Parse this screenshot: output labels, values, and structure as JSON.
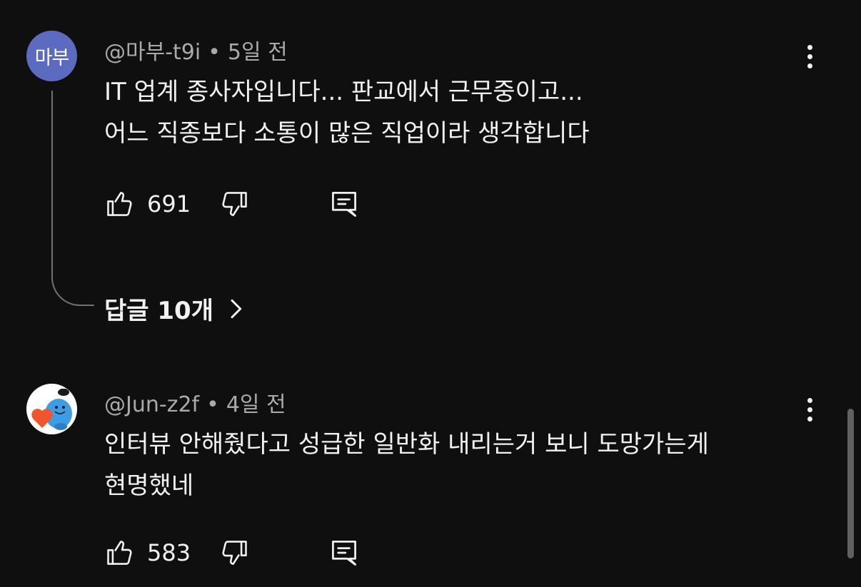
{
  "comments": [
    {
      "avatar_text": "마부",
      "author": "@마부-t9i",
      "separator": "•",
      "time": "5일 전",
      "lines": [
        "IT 업계 종사자입니다... 판교에서 근무중이고...",
        "어느 직종보다 소통이 많은 직업이라 생각합니다"
      ],
      "likes": "691",
      "replies_label": "답글 10개"
    },
    {
      "author": "@Jun-z2f",
      "separator": "•",
      "time": "4일 전",
      "lines": [
        "인터뷰 안해줬다고 성급한 일반화 내리는거 보니 도망가는게",
        "현명했네"
      ],
      "likes": "583"
    }
  ],
  "colors": {
    "background": "#0f0f0f",
    "text_primary": "#f1f1f1",
    "text_secondary": "#aaaaaa",
    "avatar_purple": "#5c6bc0",
    "thread_line": "#717171",
    "scrollbar": "#606060"
  },
  "icons": [
    "thumb-up-icon",
    "thumb-down-icon",
    "reply-icon",
    "more-vert-icon",
    "chevron-right-icon"
  ]
}
